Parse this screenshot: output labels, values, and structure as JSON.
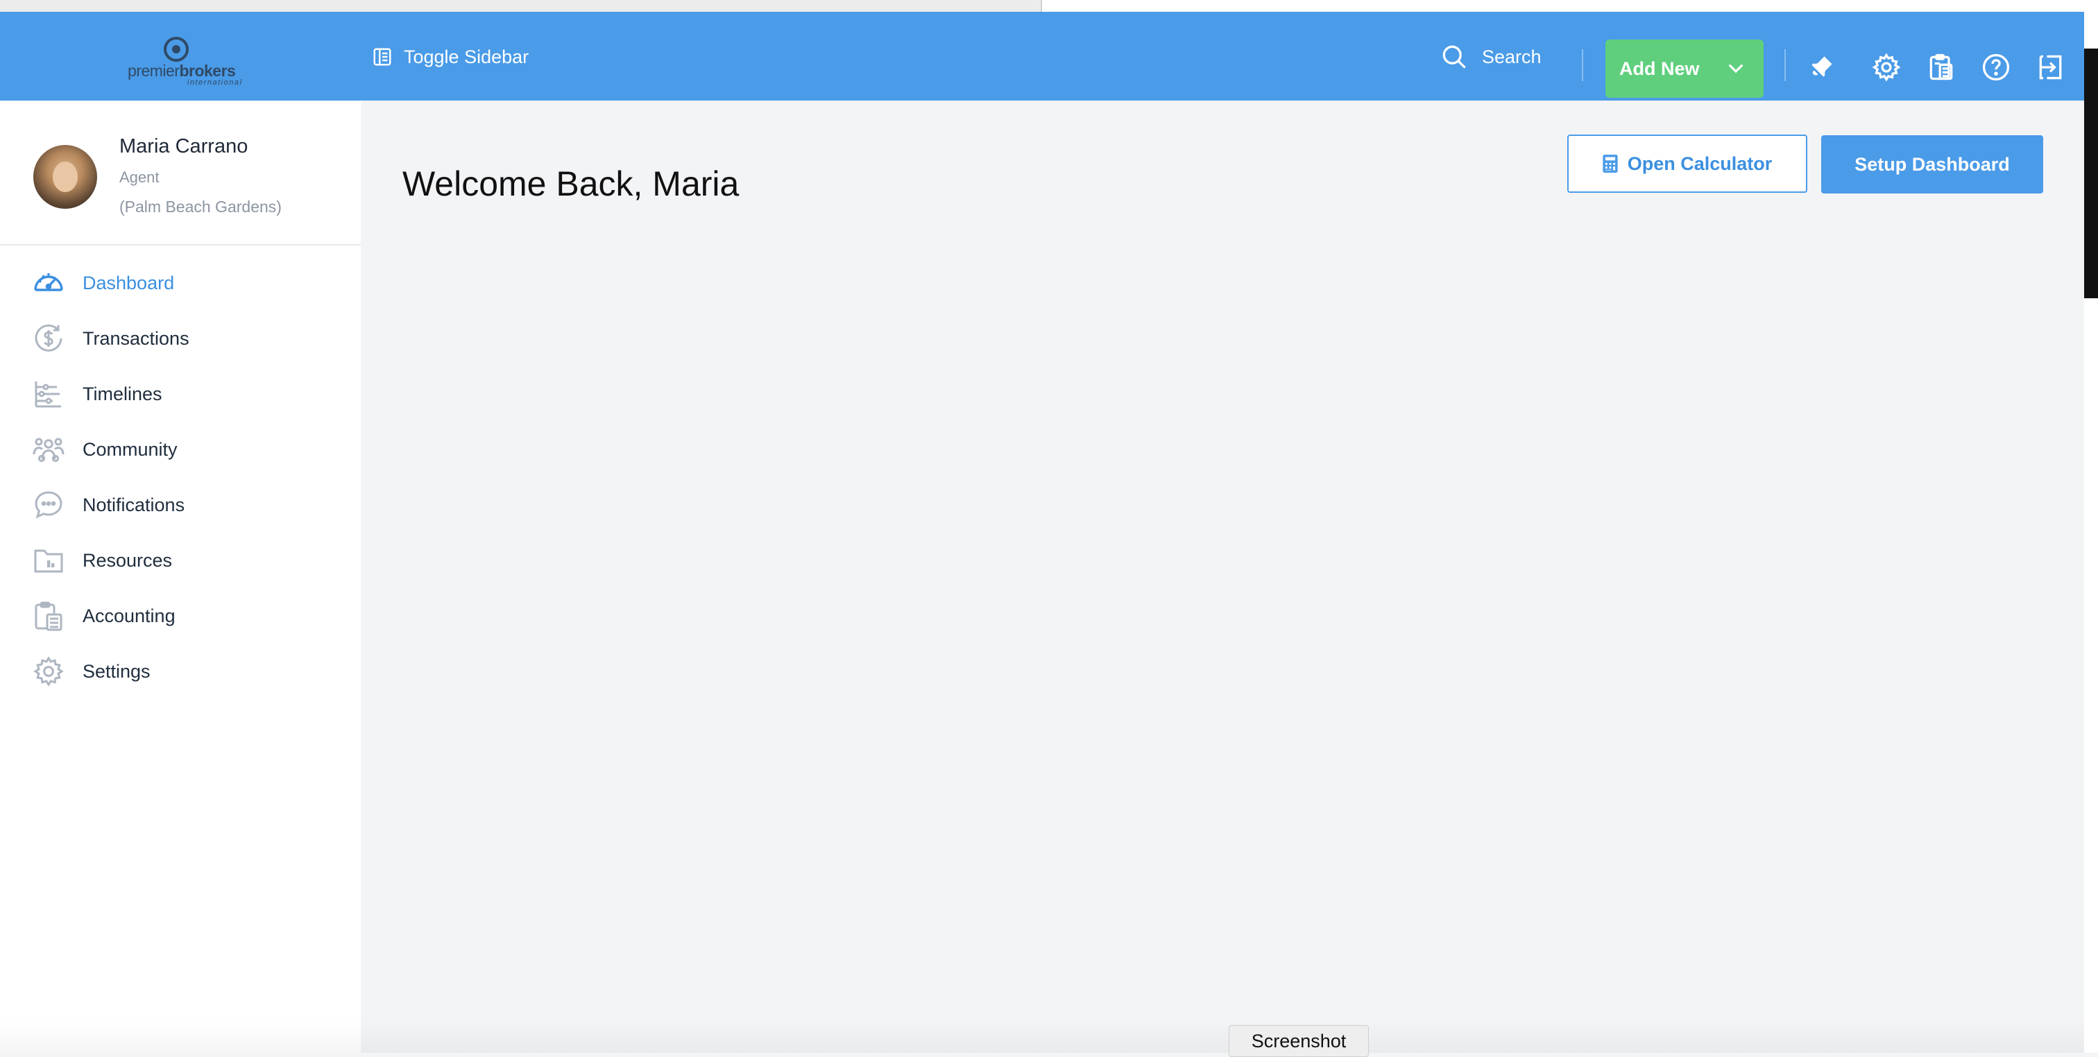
{
  "header": {
    "logo": {
      "text_bold": "brokers",
      "text_light": "premier",
      "text_sub": "international"
    },
    "toggle_sidebar_label": "Toggle Sidebar",
    "search_label": "Search",
    "add_new_label": "Add New",
    "icons": [
      "bell-icon",
      "gear-icon",
      "calculator-icon",
      "help-icon",
      "logout-icon"
    ],
    "bar_color": "#4a9be8",
    "add_new_color": "#5fcf7d"
  },
  "user": {
    "name": "Maria Carrano",
    "role": "Agent",
    "office": "(Palm Beach Gardens)"
  },
  "sidebar": {
    "items": [
      {
        "label": "Dashboard",
        "icon": "dashboard-gauge-icon",
        "active": true
      },
      {
        "label": "Transactions",
        "icon": "dollar-cycle-icon",
        "active": false
      },
      {
        "label": "Timelines",
        "icon": "timeline-icon",
        "active": false
      },
      {
        "label": "Community",
        "icon": "community-icon",
        "active": false
      },
      {
        "label": "Notifications",
        "icon": "chat-bubble-icon",
        "active": false
      },
      {
        "label": "Resources",
        "icon": "folder-icon",
        "active": false
      },
      {
        "label": "Accounting",
        "icon": "accounting-icon",
        "active": false
      },
      {
        "label": "Settings",
        "icon": "gear-icon",
        "active": false
      }
    ]
  },
  "main": {
    "title": "Welcome Back, Maria",
    "open_calculator_label": "Open Calculator",
    "setup_dashboard_label": "Setup Dashboard"
  },
  "overlay": {
    "tooltip_label": "Screenshot"
  }
}
